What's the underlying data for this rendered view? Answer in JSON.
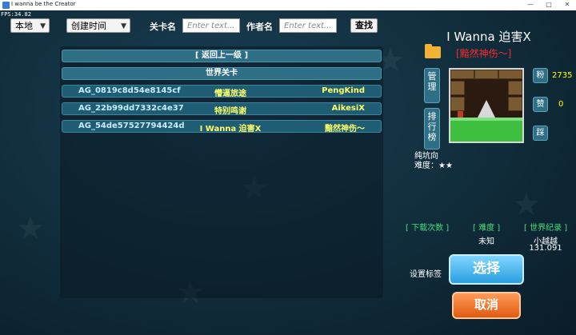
{
  "window": {
    "title": "I wanna be the Creator",
    "fps": "FPS:34.82",
    "minimize": "—",
    "maximize": "□",
    "close": "✕"
  },
  "filters": {
    "source": "本地",
    "sort": "创建时间",
    "level_name_label": "关卡名",
    "level_name_placeholder": "Enter text...",
    "author_label": "作者名",
    "author_placeholder": "Enter text...",
    "search": "查找"
  },
  "list": {
    "back": "[ 返回上一级 ]",
    "section": "世界关卡",
    "rows": [
      {
        "id": "AG_0819c8d54e8145cf",
        "name": "懵逼旅途",
        "author": "PengKind"
      },
      {
        "id": "AG_22b99dd7332c4e37",
        "name": "特别鸣谢",
        "author": "AikesiX"
      },
      {
        "id": "AG_54de57527794424d",
        "name": "I Wanna 迫害X",
        "author": "黯然神伤～"
      }
    ]
  },
  "detail": {
    "title": "I Wanna 迫害X",
    "author": "[黯然神伤～]",
    "manage": "管理",
    "ranking": "排行榜",
    "fans_label": "粉",
    "fans_count": "2735",
    "like_label": "赞",
    "like_count": "0",
    "dislike_label": "踩",
    "type": "纯坑向",
    "difficulty_label": "难度：",
    "difficulty_stars": "★★",
    "stats_headers": [
      "[ 下载次数 ]",
      "[ 难度 ]",
      "[ 世界纪录 ]"
    ],
    "difficulty_value": "未知",
    "record_holder": "小越越",
    "record_time": "131.091",
    "set_tags": "设置标签",
    "select": "选择",
    "cancel": "取消"
  }
}
